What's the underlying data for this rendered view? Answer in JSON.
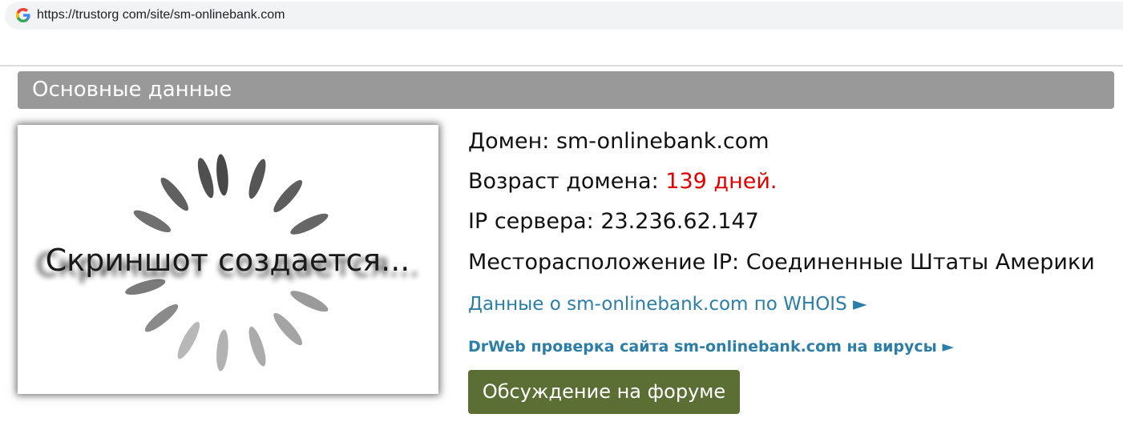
{
  "browser": {
    "url": "https://trustorg com/site/sm-onlinebank.com",
    "search_engine_icon": "google-g-icon"
  },
  "section": {
    "title": "Основные данные"
  },
  "screenshot_placeholder": {
    "caption": "Скриншот создается...",
    "icon": "loading-spinner-icon"
  },
  "info": {
    "domain_label": "Домен:",
    "domain_value": "sm-onlinebank.com",
    "age_label": "Возраст домена:",
    "age_value": "139 дней.",
    "ip_label": "IP сервера:",
    "ip_value": "23.236.62.147",
    "location_label": "Месторасположение IP:",
    "location_value": "Соединенные Штаты Америки"
  },
  "links": {
    "whois": "Данные о sm-onlinebank.com по WHOIS ►",
    "drweb": "DrWeb проверка сайта sm-onlinebank.com на вирусы ►"
  },
  "forum_button": {
    "label": "Обсуждение на форуме"
  },
  "colors": {
    "header_bg": "#999999",
    "age_value": "#e00000",
    "link": "#2b7ea8",
    "button_bg": "#5b6e34"
  }
}
